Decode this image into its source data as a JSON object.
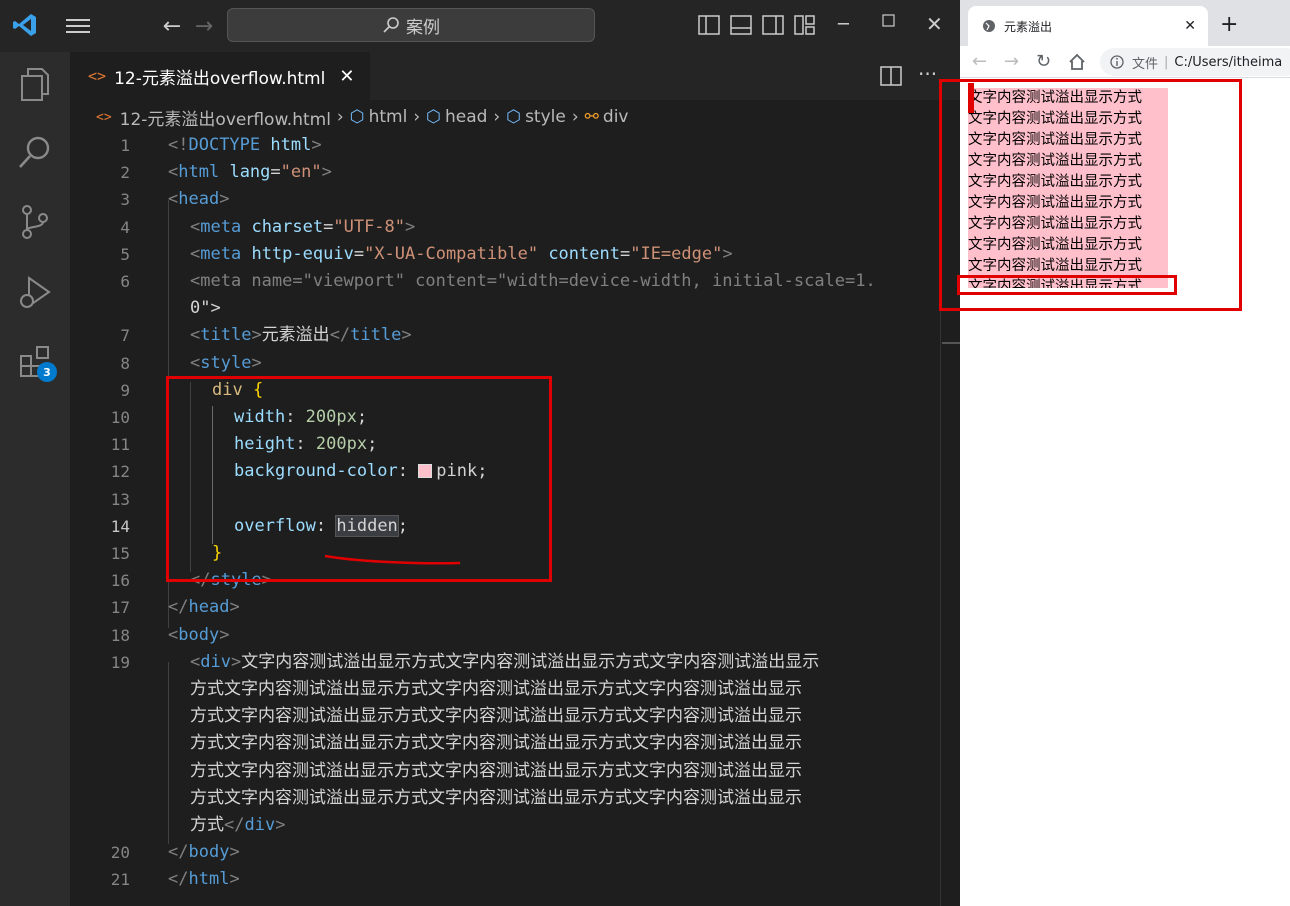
{
  "vscode": {
    "search_label": "案例",
    "tab": {
      "label": "12-元素溢出overflow.html"
    },
    "breadcrumb": [
      "12-元素溢出overflow.html",
      "html",
      "head",
      "style",
      "div"
    ],
    "extensions_badge": "3",
    "line_numbers": [
      "1",
      "2",
      "3",
      "4",
      "5",
      "6",
      "",
      "7",
      "8",
      "9",
      "10",
      "11",
      "12",
      "13",
      "14",
      "15",
      "16",
      "17",
      "18",
      "19",
      "",
      "",
      "",
      "",
      "",
      "",
      "20",
      "21"
    ],
    "code": [
      "<!DOCTYPE html>",
      "<html lang=\"en\">",
      "<head>",
      "<meta charset=\"UTF-8\">",
      "<meta http-equiv=\"X-UA-Compatible\" content=\"IE=edge\">",
      "<meta name=\"viewport\" content=\"width=device-width, initial-scale=1.",
      "0\">",
      "<title>元素溢出</title>",
      "<style>",
      "div {",
      "width: 200px;",
      "height: 200px;",
      "background-color: pink;",
      "",
      "overflow: hidden;",
      "}",
      "</style>",
      "</head>",
      "<body>",
      "<div>文字内容测试溢出显示方式文字内容测试溢出显示方式文字内容测试溢出显示",
      "方式文字内容测试溢出显示方式文字内容测试溢出显示方式文字内容测试溢出显示",
      "方式文字内容测试溢出显示方式文字内容测试溢出显示方式文字内容测试溢出显示",
      "方式文字内容测试溢出显示方式文字内容测试溢出显示方式文字内容测试溢出显示",
      "方式文字内容测试溢出显示方式文字内容测试溢出显示方式文字内容测试溢出显示",
      "方式文字内容测试溢出显示方式文字内容测试溢出显示方式文字内容测试溢出显示",
      "方式</div>",
      "</body>",
      "</html>"
    ]
  },
  "browser": {
    "tab_title": "元素溢出",
    "address_prefix": "文件",
    "address": "C:/Users/itheima",
    "lines": [
      "文字内容测试溢出显示方式",
      "文字内容测试溢出显示方式",
      "文字内容测试溢出显示方式",
      "文字内容测试溢出显示方式",
      "文字内容测试溢出显示方式",
      "文字内容测试溢出显示方式",
      "文字内容测试溢出显示方式",
      "文字内容测试溢出显示方式",
      "文字内容测试溢出显示方式",
      "文字内容测试溢出显示方式"
    ]
  },
  "colors": {
    "accent": "#007acc",
    "highlight": "#e00000",
    "pink": "#ffc0cb"
  }
}
